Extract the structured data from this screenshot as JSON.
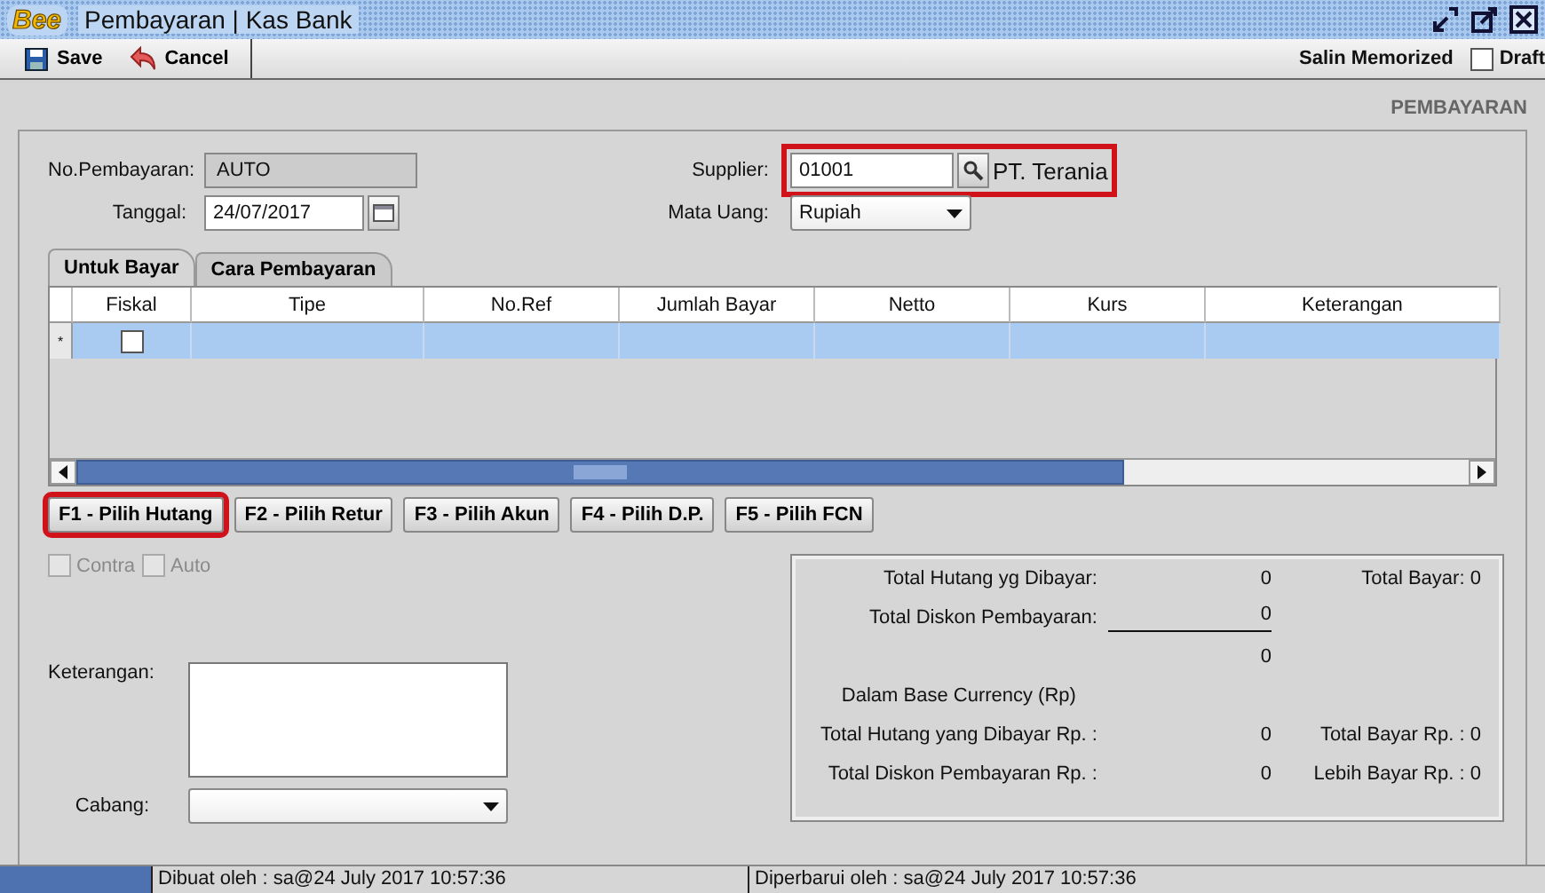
{
  "window": {
    "logo": "Bee",
    "title": "Pembayaran | Kas Bank"
  },
  "toolbar": {
    "buttons": [
      {
        "label": "Save",
        "kind": "save"
      },
      {
        "label": "Cancel",
        "kind": "cancel"
      }
    ],
    "salin": "Salin Memorized",
    "draft": {
      "label": "Draft",
      "checked": false
    }
  },
  "form_title": "PEMBAYARAN",
  "header": {
    "no_pembayaran": {
      "label": "No.Pembayaran:",
      "value": "AUTO"
    },
    "tanggal": {
      "label": "Tanggal:",
      "value": "24/07/2017"
    },
    "supplier": {
      "label": "Supplier:",
      "value": "01001",
      "name": "PT. Terania",
      "highlighted": true
    },
    "mata_uang": {
      "label": "Mata Uang:",
      "value": "Rupiah"
    }
  },
  "tabs": [
    {
      "label": "Untuk Bayar",
      "selected": true
    },
    {
      "label": "Cara Pembayaran",
      "selected": false
    }
  ],
  "table": {
    "columns": [
      "Fiskal",
      "Tipe",
      "No.Ref",
      "Jumlah Bayar",
      "Netto",
      "Kurs",
      "Keterangan"
    ],
    "rows": [
      {
        "marker": "*",
        "fiskal": false,
        "selected": true
      }
    ]
  },
  "actions": [
    {
      "label": "F1 - Pilih Hutang",
      "highlighted": true
    },
    {
      "label": "F2 - Pilih Retur",
      "highlighted": false
    },
    {
      "label": "F3 - Pilih Akun",
      "highlighted": false
    },
    {
      "label": "F4 - Pilih D.P.",
      "highlighted": false
    },
    {
      "label": "F5 - Pilih FCN",
      "highlighted": false
    }
  ],
  "options": [
    {
      "label": "Contra",
      "checked": false,
      "disabled": true
    },
    {
      "label": "Auto",
      "checked": false,
      "disabled": true
    }
  ],
  "keterangan": {
    "label": "Keterangan:"
  },
  "cabang": {
    "label": "Cabang:"
  },
  "totals": {
    "rows": [
      {
        "label": "Total Hutang yg Dibayar:",
        "value": "0",
        "side_label": "Total Bayar:",
        "side_value": "0"
      },
      {
        "label": "Total Diskon Pembayaran:",
        "value": "0",
        "underline": true
      },
      {
        "value": "0"
      },
      {
        "label": "Dalam Base Currency (Rp)",
        "kind": "heading"
      },
      {
        "label": "Total Hutang yang Dibayar Rp. :",
        "value": "0",
        "side_label": "Total Bayar Rp. :",
        "side_value": "0"
      },
      {
        "label": "Total Diskon Pembayaran Rp. :",
        "value": "0",
        "side_label": "Lebih Bayar Rp. :",
        "side_value": "0"
      }
    ]
  },
  "status_bar": {
    "created": "Dibuat oleh : sa@24 July 2017  10:57:36",
    "updated": "Diperbarui oleh : sa@24 July 2017  10:57:36"
  }
}
